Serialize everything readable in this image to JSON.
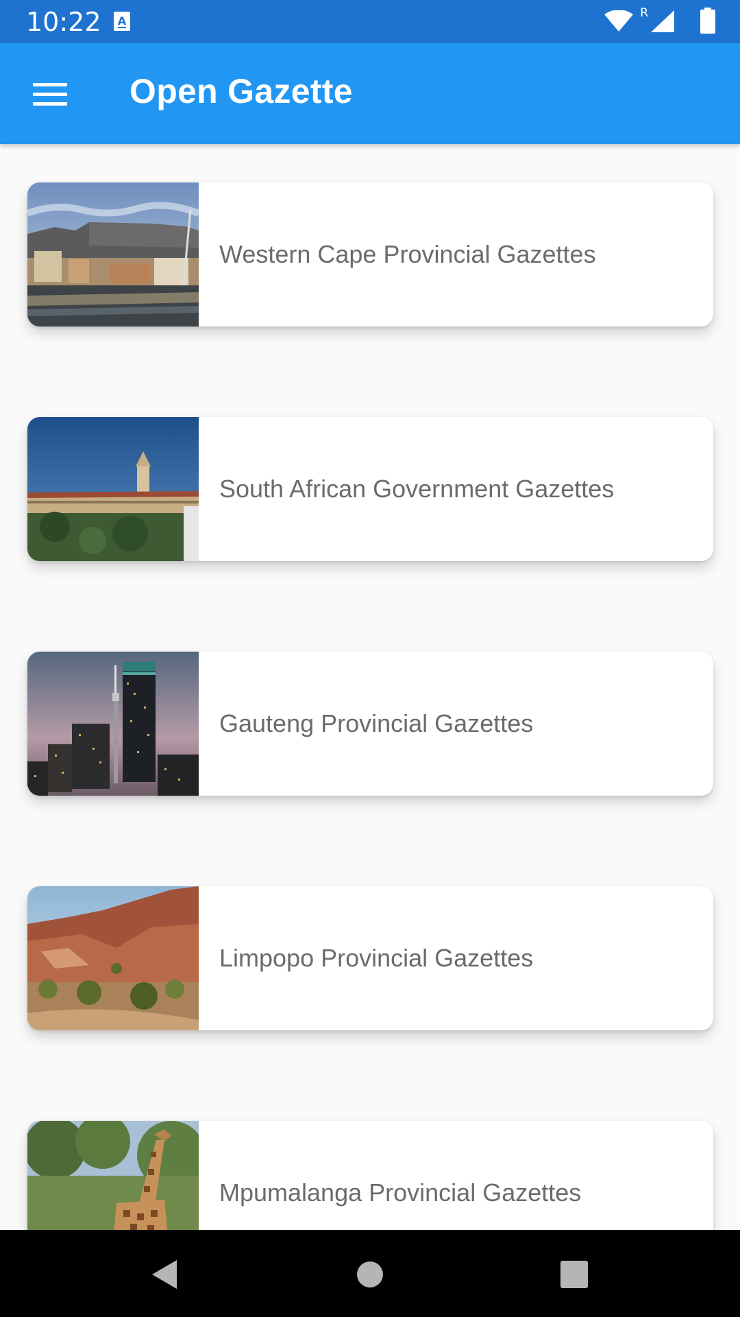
{
  "status_bar": {
    "time": "10:22",
    "notification_icon": "font-a-icon",
    "roaming_label": "R",
    "icons": [
      "wifi-icon",
      "signal-icon",
      "battery-icon"
    ]
  },
  "app_bar": {
    "menu_icon": "hamburger-menu-icon",
    "title": "Open Gazette",
    "color": "#2196f3"
  },
  "gazettes": [
    {
      "label": "Western Cape Provincial Gazettes",
      "image": "cape-town-waterfront-photo"
    },
    {
      "label": "South African Government Gazettes",
      "image": "union-buildings-photo"
    },
    {
      "label": "Gauteng Provincial Gazettes",
      "image": "johannesburg-skyline-photo"
    },
    {
      "label": "Limpopo Provincial Gazettes",
      "image": "limpopo-landscape-photo"
    },
    {
      "label": "Mpumalanga Provincial Gazettes",
      "image": "giraffe-photo"
    }
  ],
  "nav_bar": {
    "buttons": [
      "back-icon",
      "home-icon",
      "recents-icon"
    ]
  }
}
